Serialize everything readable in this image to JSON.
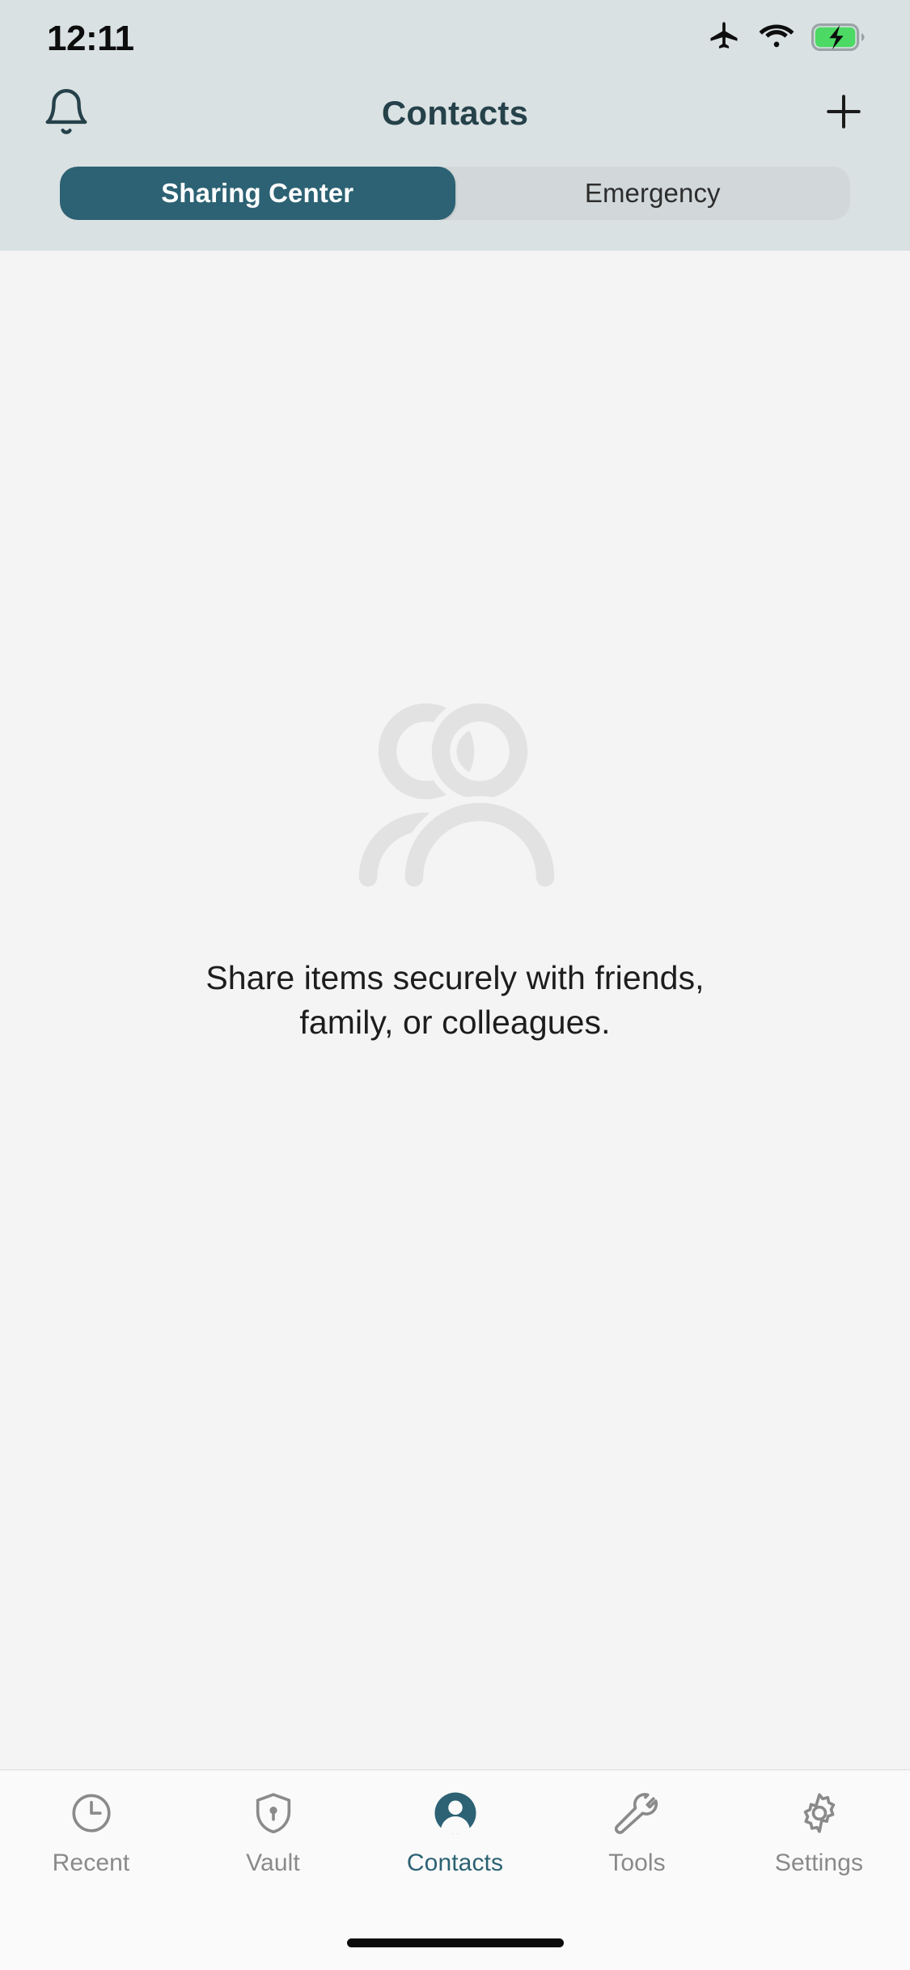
{
  "status_bar": {
    "time": "12:11",
    "icons": [
      "airplane-mode-icon",
      "wifi-icon",
      "battery-charging-icon"
    ],
    "battery_charging": true,
    "battery_color": "#4cd964"
  },
  "nav_bar": {
    "title": "Contacts",
    "left_icon": "bell-icon",
    "right_icon": "plus-icon"
  },
  "segmented_control": {
    "selected_index": 0,
    "active_color": "#2c6273",
    "track_color": "#d2d8da",
    "items": [
      {
        "label": "Sharing Center"
      },
      {
        "label": "Emergency"
      }
    ]
  },
  "empty_state": {
    "illustration": "people-icon",
    "illustration_color": "#e2e2e2",
    "line1": "Share items securely with friends,",
    "line2": "family, or colleagues."
  },
  "tab_bar": {
    "selected_index": 2,
    "active_color": "#2c6273",
    "inactive_color": "#8a8a8a",
    "items": [
      {
        "label": "Recent",
        "icon": "clock-icon"
      },
      {
        "label": "Vault",
        "icon": "shield-lock-icon"
      },
      {
        "label": "Contacts",
        "icon": "person-filled-icon"
      },
      {
        "label": "Tools",
        "icon": "wrench-icon"
      },
      {
        "label": "Settings",
        "icon": "gear-icon"
      }
    ]
  },
  "theme": {
    "header_bg": "#dae1e3",
    "body_bg": "#f4f4f4",
    "tabbar_bg": "#fafafa",
    "title_color": "#25414a"
  }
}
